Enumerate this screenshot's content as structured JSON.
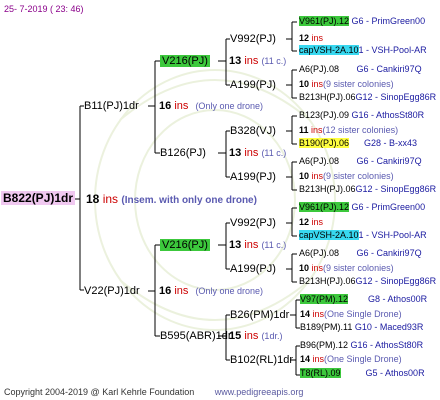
{
  "date_stamp": "25-  7-2019 ( 23: 46)",
  "root": {
    "label": "B822(PJ)1dr",
    "count": "18",
    "unit": "ins",
    "note": "(Insem. with only one drone)"
  },
  "sire": {
    "label": "B11(PJ)1dr",
    "count": "16",
    "unit": "ins",
    "note": "(Only one drone)",
    "gs_a": {
      "label": "V216(PJ)",
      "count": "13",
      "unit": "ins",
      "note": "(11 c.)",
      "v992": {
        "label": "V992(PJ)",
        "count": "12",
        "unit": "ins",
        "s1": {
          "code": "V961(PJ).12",
          "info": "G6 - PrimGreen00"
        },
        "s2": {
          "code": "capVSH-2A.10",
          "info": "1 - VSH-Pool-AR"
        }
      },
      "a199": {
        "label": "A199(PJ)",
        "count": "10",
        "unit": "ins",
        "note": "(9 sister colonies)",
        "s1": {
          "code": "A6(PJ).08",
          "info": "G6 - Cankiri97Q"
        },
        "s2": {
          "code": "B213H(PJ).06",
          "info": "G12 - SinopEgg86R"
        }
      }
    },
    "gs_b": {
      "label": "B126(PJ)",
      "count": "13",
      "unit": "ins",
      "note": "(11 c.)",
      "b328": {
        "label": "B328(VJ)",
        "count": "11",
        "unit": "ins",
        "note": "(12 sister colonies)",
        "s1": {
          "code": "B123(PJ).09",
          "info": "G16 - AthosSt80R"
        },
        "s2": {
          "code": "B190(PJ).06",
          "info": "G28 - B-xx43"
        }
      },
      "a199": {
        "label": "A199(PJ)",
        "count": "10",
        "unit": "ins",
        "note": "(9 sister colonies)",
        "s1": {
          "code": "A6(PJ).08",
          "info": "G6 - Cankiri97Q"
        },
        "s2": {
          "code": "B213H(PJ).06",
          "info": "G12 - SinopEgg86R"
        }
      }
    }
  },
  "dam": {
    "label": "V22(PJ)1dr",
    "count": "16",
    "unit": "ins",
    "note": "(Only one drone)",
    "gs_a": {
      "label": "V216(PJ)",
      "count": "13",
      "unit": "ins",
      "note": "(11 c.)",
      "v992": {
        "label": "V992(PJ)",
        "count": "12",
        "unit": "ins",
        "s1": {
          "code": "V961(PJ).12",
          "info": "G6 - PrimGreen00"
        },
        "s2": {
          "code": "capVSH-2A.10",
          "info": "1 - VSH-Pool-AR"
        }
      },
      "a199": {
        "label": "A199(PJ)",
        "count": "10",
        "unit": "ins",
        "note": "(9 sister colonies)",
        "s1": {
          "code": "A6(PJ).08",
          "info": "G6 - Cankiri97Q"
        },
        "s2": {
          "code": "B213H(PJ).06",
          "info": "G12 - SinopEgg86R"
        }
      }
    },
    "gs_b": {
      "label": "B595(ABR)1dr",
      "count": "15",
      "unit": "ins",
      "note": "(1dr.)",
      "b26": {
        "label": "B26(PM)1dr",
        "count": "14",
        "unit": "ins",
        "note": "(One Single Drone)",
        "s1": {
          "code": "V97(PM).12",
          "info": "G8 - Athos00R"
        },
        "s2": {
          "code": "B189(PM).11",
          "info": "G10 - Maced93R"
        }
      },
      "b102": {
        "label": "B102(RL)1dr",
        "count": "14",
        "unit": "ins",
        "note": "(One Single Drone)",
        "s1": {
          "code": "B96(PM).12",
          "info": "G16 - AthosSt80R"
        },
        "s2": {
          "code": "T8(RL).09",
          "info": "G5 - Athos00R"
        }
      }
    }
  },
  "footer": {
    "copyright": "Copyright 2004-2019 @ Karl Kehrle Foundation",
    "site": "www.pedigreeapis.org"
  },
  "colors": {
    "highlight_green": "#3cc83c",
    "highlight_cyan": "#38d8f0",
    "highlight_yellow": "#ffff40",
    "root_bg": "#f0c8f0",
    "ins_red": "#cc0000"
  }
}
